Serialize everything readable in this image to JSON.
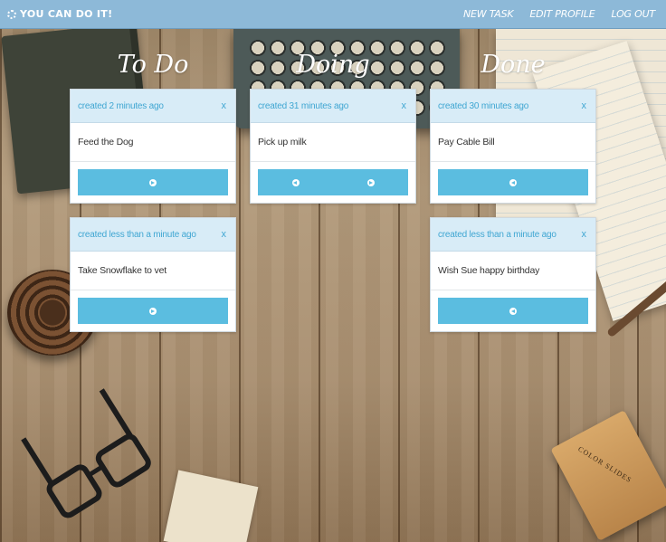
{
  "navbar": {
    "brand": "YOU CAN DO IT!",
    "links": [
      "NEW TASK",
      "EDIT PROFILE",
      "LOG OUT"
    ]
  },
  "columns": [
    {
      "title": "To Do",
      "cards": [
        {
          "meta": "created 2 minutes ago",
          "close": "x",
          "text": "Feed the Dog",
          "buttons": [
            "arrow-right-icon"
          ]
        },
        {
          "meta": "created less than a minute ago",
          "close": "x",
          "text": "Take Snowflake to vet",
          "buttons": [
            "arrow-right-icon"
          ]
        }
      ]
    },
    {
      "title": "Doing",
      "cards": [
        {
          "meta": "created 31 minutes ago",
          "close": "x",
          "text": "Pick up milk",
          "buttons": [
            "arrow-left-icon",
            "arrow-right-icon"
          ]
        }
      ]
    },
    {
      "title": "Done",
      "cards": [
        {
          "meta": "created 30 minutes ago",
          "close": "x",
          "text": "Pay Cable Bill",
          "buttons": [
            "arrow-left-icon"
          ]
        },
        {
          "meta": "created less than a minute ago",
          "close": "x",
          "text": "Wish Sue happy birthday",
          "buttons": [
            "arrow-left-icon"
          ]
        }
      ]
    }
  ],
  "background": {
    "slide_box_label": "COLOR SLIDES"
  },
  "colors": {
    "navbar": "#8db9d8",
    "card_header": "#d8ecf7",
    "accent": "#3fa6d2",
    "button": "#5bbde0"
  }
}
